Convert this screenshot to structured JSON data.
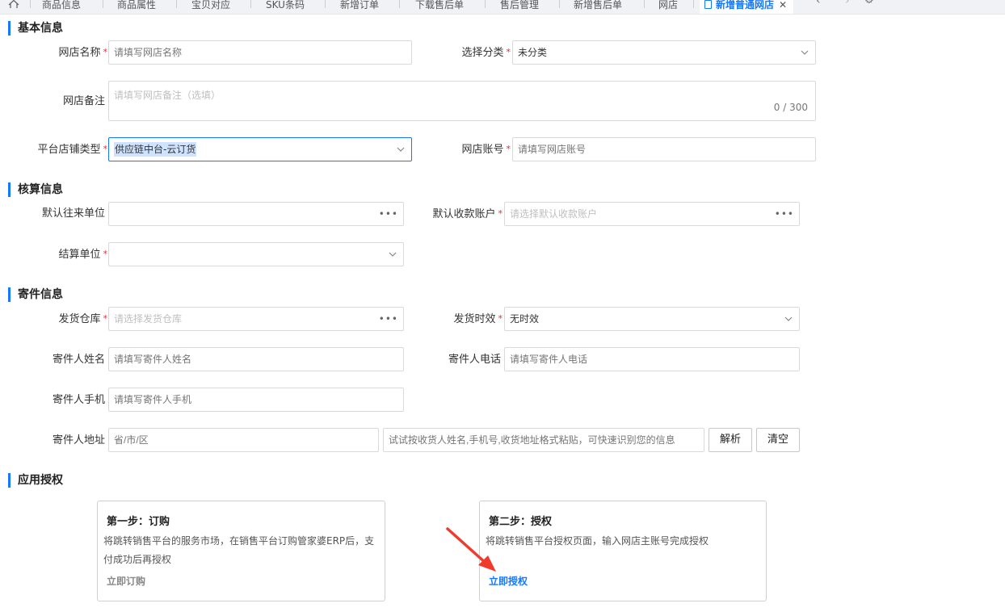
{
  "tabs": [
    {
      "label": "商品信息"
    },
    {
      "label": "商品属性"
    },
    {
      "label": "宝贝对应"
    },
    {
      "label": "SKU条码"
    },
    {
      "label": "新增订单"
    },
    {
      "label": "下载售后单"
    },
    {
      "label": "售后管理"
    },
    {
      "label": "新增售后单"
    },
    {
      "label": "网店"
    },
    {
      "label": "新增普通网店",
      "active": true
    }
  ],
  "tab_close": "✕",
  "sections": {
    "basic": "基本信息",
    "accounting": "核算信息",
    "shipping": "寄件信息",
    "auth": "应用授权"
  },
  "basic": {
    "shop_name": {
      "label": "网店名称",
      "placeholder": "请填写网店名称",
      "required": true
    },
    "category": {
      "label": "选择分类",
      "value": "未分类",
      "required": true
    },
    "remark": {
      "label": "网店备注",
      "placeholder": "请填写网店备注（选填）",
      "counter": "0 / 300"
    },
    "platform_type": {
      "label": "平台店铺类型",
      "value": "供应链中台-云订货",
      "required": true
    },
    "shop_account": {
      "label": "网店账号",
      "placeholder": "请填写网店账号",
      "required": true
    }
  },
  "accounting": {
    "default_unit": {
      "label": "默认往来单位",
      "value": ""
    },
    "default_account": {
      "label": "默认收款账户",
      "placeholder": "请选择默认收款账户",
      "required": true
    },
    "settle_unit": {
      "label": "结算单位",
      "value": "",
      "required": true
    }
  },
  "shipping": {
    "warehouse": {
      "label": "发货仓库",
      "placeholder": "请选择发货仓库",
      "required": true
    },
    "timeliness": {
      "label": "发货时效",
      "value": "无时效",
      "required": true
    },
    "sender_name": {
      "label": "寄件人姓名",
      "placeholder": "请填写寄件人姓名"
    },
    "sender_phone": {
      "label": "寄件人电话",
      "placeholder": "请填写寄件人电话"
    },
    "sender_mobile": {
      "label": "寄件人手机",
      "placeholder": "请填写寄件人手机"
    },
    "sender_address": {
      "label": "寄件人地址",
      "region_placeholder": "省/市/区",
      "parse_placeholder": "试试按收货人姓名,手机号,收货地址格式粘贴，可快速识别您的信息"
    },
    "parse_button": "解析",
    "clear_button": "清空"
  },
  "auth": {
    "step1": {
      "title": "第一步：订购",
      "desc": "将跳转销售平台的服务市场，在销售平台订购管家婆ERP后，支付成功后再授权",
      "link": "立即订购"
    },
    "step2": {
      "title": "第二步：授权",
      "desc": "将跳转销售平台授权页面，输入网店主账号完成授权",
      "link": "立即授权"
    }
  },
  "colors": {
    "accent": "#1677ff",
    "required": "#f5222d",
    "annotation_arrow": "#f03a2c"
  }
}
